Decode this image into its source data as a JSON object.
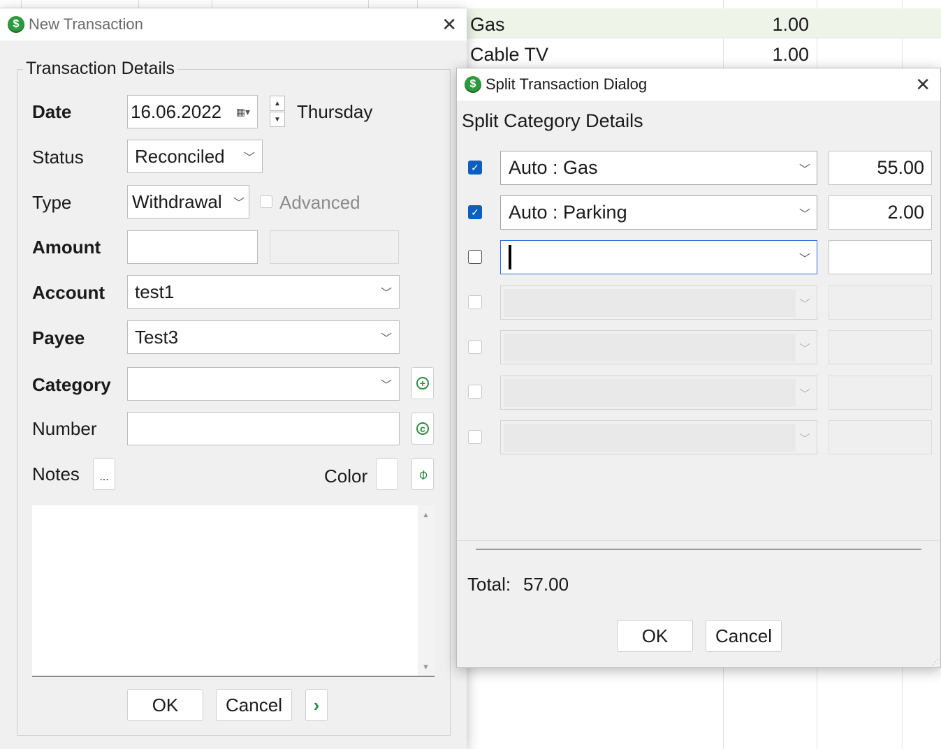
{
  "background_register": {
    "rows": [
      {
        "payee": "Gas",
        "amount": "1.00",
        "selected": true
      },
      {
        "payee": "Cable TV",
        "amount": "1.00",
        "selected": false
      }
    ]
  },
  "new_transaction": {
    "title": "New Transaction",
    "group_title": "Transaction Details",
    "labels": {
      "date": "Date",
      "status": "Status",
      "type": "Type",
      "amount": "Amount",
      "account": "Account",
      "payee": "Payee",
      "category": "Category",
      "number": "Number",
      "notes": "Notes",
      "color": "Color"
    },
    "date_value": "16.06.2022",
    "weekday": "Thursday",
    "status_value": "Reconciled",
    "type_value": "Withdrawal",
    "advanced_label": "Advanced",
    "amount_value": "",
    "account_value": "test1",
    "payee_value": "Test3",
    "category_value": "",
    "number_value": "",
    "notes_button": "...",
    "notes_text": "",
    "ok": "OK",
    "cancel": "Cancel",
    "more": "›"
  },
  "split_dialog": {
    "title": "Split Transaction Dialog",
    "heading": "Split Category Details",
    "rows": [
      {
        "checked": true,
        "category": "Auto : Gas",
        "amount": "55.00"
      },
      {
        "checked": true,
        "category": "Auto : Parking",
        "amount": "2.00"
      },
      {
        "checked": false,
        "category": "",
        "amount": ""
      },
      {
        "checked": false,
        "category": "",
        "amount": ""
      },
      {
        "checked": false,
        "category": "",
        "amount": ""
      },
      {
        "checked": false,
        "category": "",
        "amount": ""
      },
      {
        "checked": false,
        "category": "",
        "amount": ""
      }
    ],
    "total_label": "Total:",
    "total_value": "57.00",
    "ok": "OK",
    "cancel": "Cancel"
  },
  "colors": {
    "accent_check": "#0c5fc0",
    "app_icon": "#2e9a3e",
    "selected_row": "#eef5e8"
  }
}
